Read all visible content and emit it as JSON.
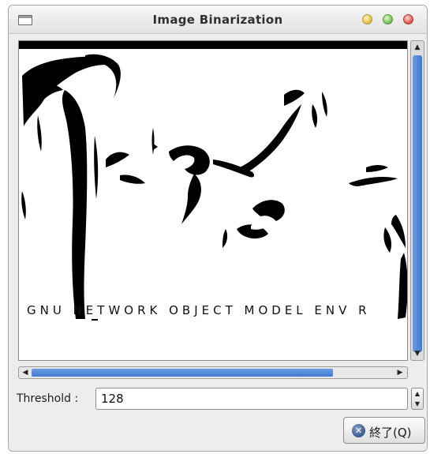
{
  "window": {
    "title": "Image Binarization"
  },
  "image": {
    "text_overlay": "GNU NETWORK OBJECT MODEL ENV R"
  },
  "scrollbars": {
    "vertical_up": "▲",
    "vertical_down": "▼",
    "horizontal_left": "◀",
    "horizontal_right": "▶"
  },
  "threshold": {
    "label": "Threshold :",
    "value": "128",
    "spin_up": "▲",
    "spin_down": "▼"
  },
  "quit_button": {
    "label": "終了(Q)",
    "icon": "close-circle-icon",
    "icon_glyph": "✕"
  },
  "colors": {
    "accent": "#3f78cf",
    "window_bg": "#ededed"
  }
}
